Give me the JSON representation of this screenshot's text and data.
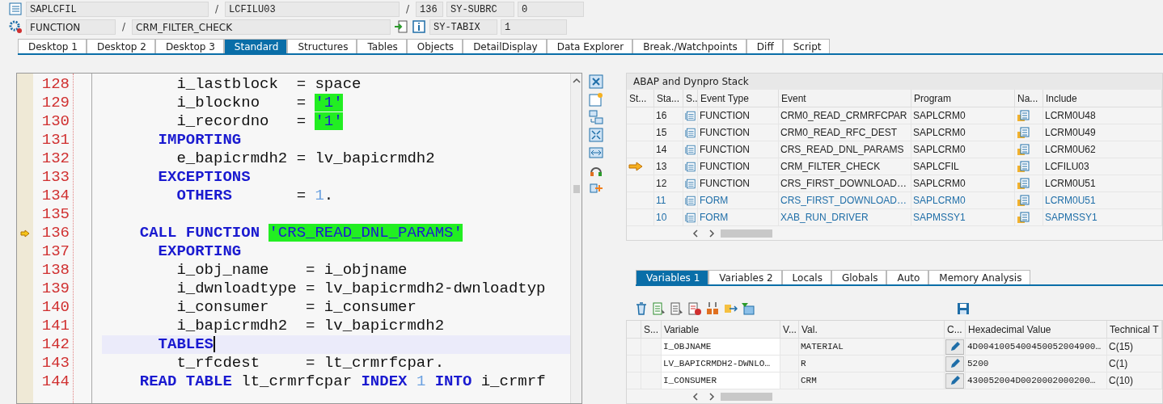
{
  "header": {
    "program": "SAPLCFIL",
    "include": "LCFILU03",
    "line": "136",
    "event_type": "FUNCTION",
    "event": "CRM_FILTER_CHECK",
    "sysvars": [
      {
        "name": "SY-SUBRC",
        "value": "0"
      },
      {
        "name": "SY-TABIX",
        "value": "1"
      }
    ]
  },
  "separators": [
    "/",
    "/",
    "/"
  ],
  "tabs": [
    {
      "label": "Desktop 1",
      "selected": false
    },
    {
      "label": "Desktop 2",
      "selected": false
    },
    {
      "label": "Desktop 3",
      "selected": false
    },
    {
      "label": "Standard",
      "selected": true
    },
    {
      "label": "Structures",
      "selected": false
    },
    {
      "label": "Tables",
      "selected": false
    },
    {
      "label": "Objects",
      "selected": false
    },
    {
      "label": "DetailDisplay",
      "selected": false
    },
    {
      "label": "Data Explorer",
      "selected": false
    },
    {
      "label": "Break./Watchpoints",
      "selected": false
    },
    {
      "label": "Diff",
      "selected": false
    },
    {
      "label": "Script",
      "selected": false
    }
  ],
  "editor": {
    "lines": [
      {
        "number": "128",
        "current": false,
        "cursor": false,
        "tokens": [
          {
            "kind": "text",
            "text": "      i_lastblock  = space"
          }
        ]
      },
      {
        "number": "129",
        "current": false,
        "cursor": false,
        "tokens": [
          {
            "kind": "text",
            "text": "      i_blockno    = "
          },
          {
            "kind": "string",
            "text": "'1'"
          }
        ]
      },
      {
        "number": "130",
        "current": false,
        "cursor": false,
        "tokens": [
          {
            "kind": "text",
            "text": "      i_recordno   = "
          },
          {
            "kind": "string",
            "text": "'1'"
          }
        ]
      },
      {
        "number": "131",
        "current": false,
        "cursor": false,
        "tokens": [
          {
            "kind": "keyword",
            "text": "    IMPORTING"
          }
        ]
      },
      {
        "number": "132",
        "current": false,
        "cursor": false,
        "tokens": [
          {
            "kind": "text",
            "text": "      e_bapicrmdh2 = lv_bapicrmdh2"
          }
        ]
      },
      {
        "number": "133",
        "current": false,
        "cursor": false,
        "tokens": [
          {
            "kind": "keyword",
            "text": "    EXCEPTIONS"
          }
        ]
      },
      {
        "number": "134",
        "current": false,
        "cursor": false,
        "tokens": [
          {
            "kind": "keyword",
            "text": "      OTHERS"
          },
          {
            "kind": "text",
            "text": "       = "
          },
          {
            "kind": "number",
            "text": "1"
          },
          {
            "kind": "text",
            "text": "."
          }
        ]
      },
      {
        "number": "135",
        "current": false,
        "cursor": false
      },
      {
        "number": "136",
        "current": true,
        "cursor": false,
        "tokens": [
          {
            "kind": "keyword",
            "text": "  CALL FUNCTION "
          },
          {
            "kind": "string",
            "text": "'CRS_READ_DNL_PARAMS'"
          }
        ]
      },
      {
        "number": "137",
        "current": false,
        "cursor": false,
        "tokens": [
          {
            "kind": "keyword",
            "text": "    EXPORTING"
          }
        ]
      },
      {
        "number": "138",
        "current": false,
        "cursor": false,
        "tokens": [
          {
            "kind": "text",
            "text": "      i_obj_name    = i_objname"
          }
        ]
      },
      {
        "number": "139",
        "current": false,
        "cursor": false,
        "tokens": [
          {
            "kind": "text",
            "text": "      i_dwnloadtype = lv_bapicrmdh2-dwnloadtyp"
          }
        ]
      },
      {
        "number": "140",
        "current": false,
        "cursor": false,
        "tokens": [
          {
            "kind": "text",
            "text": "      i_consumer    = i_consumer"
          }
        ]
      },
      {
        "number": "141",
        "current": false,
        "cursor": false,
        "tokens": [
          {
            "kind": "text",
            "text": "      i_bapicrmdh2  = lv_bapicrmdh2"
          }
        ]
      },
      {
        "number": "142",
        "current": false,
        "cursor": true,
        "tokens": [
          {
            "kind": "keyword",
            "text": "    TABLES"
          }
        ]
      },
      {
        "number": "143",
        "current": false,
        "cursor": false,
        "tokens": [
          {
            "kind": "text",
            "text": "      t_rfcdest     = lt_crmrfcpar."
          }
        ]
      },
      {
        "number": "144",
        "current": false,
        "cursor": false,
        "tokens": [
          {
            "kind": "keyword",
            "text": "  READ TABLE "
          },
          {
            "kind": "text",
            "text": "lt_crmrfcpar "
          },
          {
            "kind": "keyword",
            "text": "INDEX "
          },
          {
            "kind": "number",
            "text": "1"
          },
          {
            "kind": "keyword",
            "text": " INTO "
          },
          {
            "kind": "text",
            "text": "i_crmrf"
          }
        ]
      }
    ]
  },
  "stack": {
    "title": "ABAP and Dynpro Stack",
    "columns": [
      "St...",
      "Sta...",
      "S..",
      "Event Type",
      "Event",
      "Program",
      "Na...",
      "Include"
    ],
    "rows": [
      {
        "current": false,
        "kind": "function",
        "level": "16",
        "event_type": "FUNCTION",
        "event": "CRM0_READ_CRMRFCPAR",
        "program": "SAPLCRM0",
        "include": "LCRM0U48"
      },
      {
        "current": false,
        "kind": "function",
        "level": "15",
        "event_type": "FUNCTION",
        "event": "CRM0_READ_RFC_DEST",
        "program": "SAPLCRM0",
        "include": "LCRM0U49"
      },
      {
        "current": false,
        "kind": "function",
        "level": "14",
        "event_type": "FUNCTION",
        "event": "CRS_READ_DNL_PARAMS",
        "program": "SAPLCRM0",
        "include": "LCRM0U62"
      },
      {
        "current": true,
        "kind": "function",
        "level": "13",
        "event_type": "FUNCTION",
        "event": "CRM_FILTER_CHECK",
        "program": "SAPLCFIL",
        "include": "LCFILU03"
      },
      {
        "current": false,
        "kind": "function",
        "level": "12",
        "event_type": "FUNCTION",
        "event": "CRS_FIRST_DOWNLOAD…",
        "program": "SAPLCRM0",
        "include": "LCRM0U51"
      },
      {
        "current": false,
        "kind": "form",
        "level": "11",
        "event_type": "FORM",
        "event": "CRS_FIRST_DOWNLOAD…",
        "program": "SAPLCRM0",
        "include": "LCRM0U51"
      },
      {
        "current": false,
        "kind": "form",
        "level": "10",
        "event_type": "FORM",
        "event": "XAB_RUN_DRIVER",
        "program": "SAPMSSY1",
        "include": "SAPMSSY1"
      }
    ]
  },
  "variable_tabs": [
    {
      "label": "Variables 1",
      "selected": true
    },
    {
      "label": "Variables 2",
      "selected": false
    },
    {
      "label": "Locals",
      "selected": false
    },
    {
      "label": "Globals",
      "selected": false
    },
    {
      "label": "Auto",
      "selected": false
    },
    {
      "label": "Memory Analysis",
      "selected": false
    }
  ],
  "variables": {
    "columns": [
      "S...",
      "Variable",
      "V...",
      "Val.",
      "C...",
      "Hexadecimal Value",
      "Technical T"
    ],
    "rows": [
      {
        "variable": "I_OBJNAME",
        "value": "MATERIAL",
        "hex": "4D0041005400450052004900…",
        "type": "C(15)"
      },
      {
        "variable": "LV_BAPICRMDH2-DWNLO…",
        "value": "R",
        "hex": "5200",
        "type": "C(1)"
      },
      {
        "variable": "I_CONSUMER",
        "value": "CRM",
        "hex": "430052004D0020002000200…",
        "type": "C(10)"
      }
    ]
  }
}
